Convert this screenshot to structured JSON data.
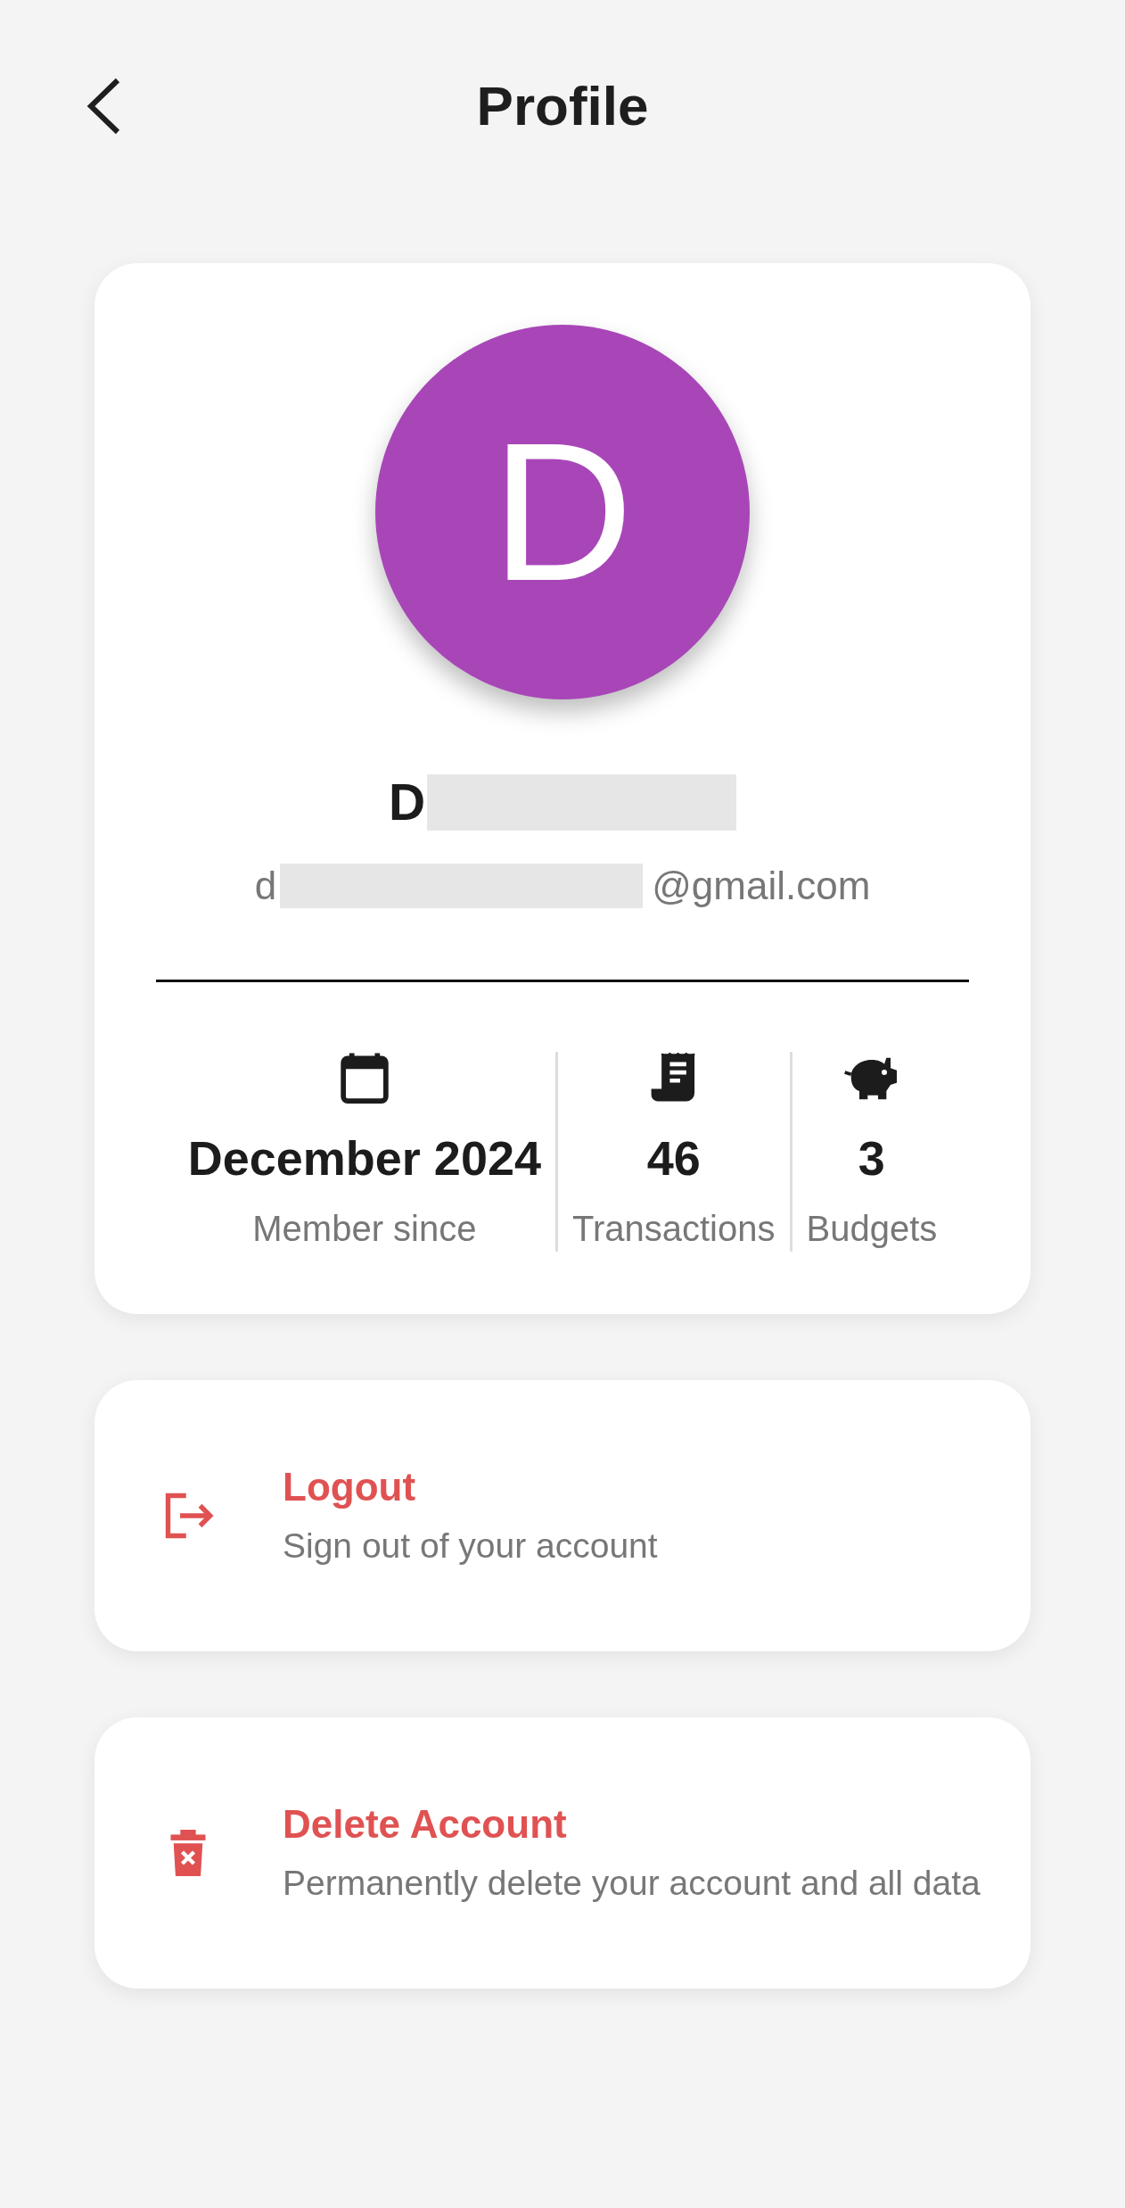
{
  "header": {
    "title": "Profile"
  },
  "profile": {
    "avatar_letter": "D",
    "name": "D",
    "name_redacted": true,
    "email_prefix": "d",
    "email_redacted": true,
    "email_suffix": "@gmail.com"
  },
  "stats": [
    {
      "kind": "calendar",
      "value": "December 2024",
      "label": "Member since"
    },
    {
      "kind": "receipt",
      "value": "46",
      "label": "Transactions"
    },
    {
      "kind": "piggy",
      "value": "3",
      "label": "Budgets"
    }
  ],
  "actions": [
    {
      "kind": "logout",
      "title": "Logout",
      "subtitle": "Sign out of your account"
    },
    {
      "kind": "delete",
      "title": "Delete Account",
      "subtitle": "Permanently delete your account and all data"
    }
  ]
}
